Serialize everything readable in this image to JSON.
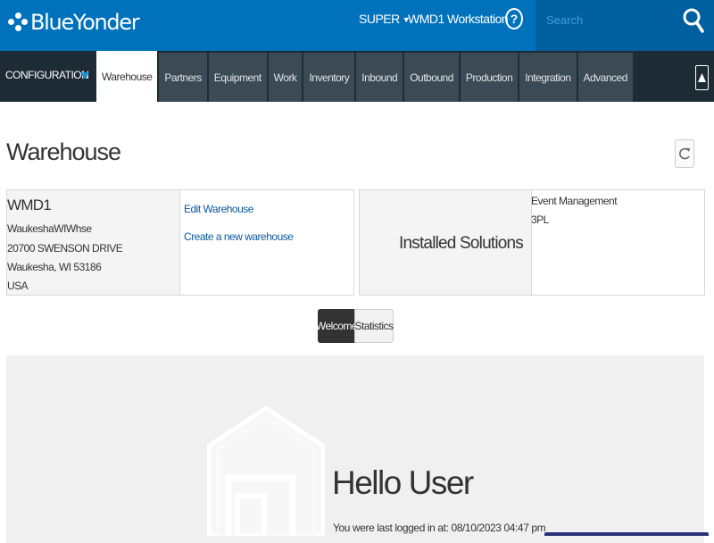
{
  "header": {
    "brand": "BlueYonder",
    "user_menu": "SUPER",
    "warehouse": "WMD1",
    "workstation": "Workstation",
    "help": "?",
    "search_placeholder": "Search"
  },
  "nav": {
    "configuration": "CONFIGURATION",
    "tabs": [
      {
        "label": "Warehouse",
        "active": true
      },
      {
        "label": "Partners"
      },
      {
        "label": "Equipment"
      },
      {
        "label": "Work"
      },
      {
        "label": "Inventory"
      },
      {
        "label": "Inbound"
      },
      {
        "label": "Outbound"
      },
      {
        "label": "Production"
      },
      {
        "label": "Integration"
      },
      {
        "label": "Advanced"
      }
    ]
  },
  "page": {
    "title": "Warehouse"
  },
  "warehouse_card": {
    "code": "WMD1",
    "name": "WaukeshaWIWhse",
    "street": "20700 SWENSON DRIVE",
    "city": "Waukesha, WI 53186",
    "country": "USA",
    "edit_link": "Edit Warehouse",
    "create_link": "Create a new warehouse"
  },
  "solutions_card": {
    "title": "Installed Solutions",
    "items": [
      "Event Management",
      "3PL"
    ]
  },
  "toggle": {
    "welcome": "Welcome",
    "statistics": "Statistics"
  },
  "welcome": {
    "greeting": "Hello User",
    "last_login": "You were last logged in at: 08/10/2023 04:47 pm"
  },
  "colors": {
    "topbar": "#0072bc",
    "nav": "#1d2b35",
    "tab": "#3b4a55",
    "link": "#0b5aa0"
  }
}
